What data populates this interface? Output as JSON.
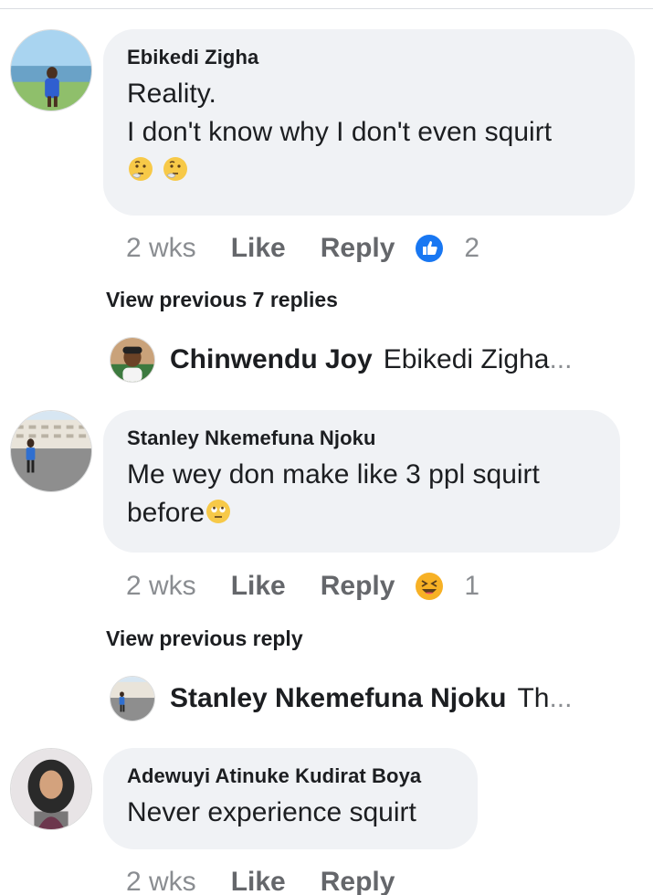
{
  "comments": [
    {
      "author": "Ebikedi Zigha",
      "lines": [
        "Reality.",
        "I don't know why I don't even squirt"
      ],
      "emojis": [
        "thinking-face",
        "thinking-face"
      ],
      "time": "2 wks",
      "like_label": "Like",
      "reply_label": "Reply",
      "reaction": {
        "icon": "like-reaction-icon",
        "count": "2",
        "color": "#1877f2"
      },
      "view_previous": "View previous 7 replies",
      "latest_reply": {
        "name": "Chinwendu Joy",
        "snippet": "Ebikedi Zigha",
        "ellipsis": "..."
      }
    },
    {
      "author": "Stanley Nkemefuna Njoku",
      "lines": [
        "Me wey don make like 3 ppl squirt",
        "before"
      ],
      "emojis": [
        "face-with-rolling-eyes"
      ],
      "time": "2 wks",
      "like_label": "Like",
      "reply_label": "Reply",
      "reaction": {
        "icon": "haha-reaction-icon",
        "count": "1",
        "color": "#f7b125"
      },
      "view_previous": "View previous reply",
      "latest_reply": {
        "name": "Stanley Nkemefuna Njoku",
        "snippet": "Th",
        "ellipsis": "..."
      }
    },
    {
      "author": "Adewuyi Atinuke Kudirat Boya",
      "lines": [
        "Never experience squirt"
      ],
      "time": "2 wks",
      "like_label": "Like",
      "reply_label": "Reply"
    }
  ],
  "colors": {
    "bubble": "#f0f2f5",
    "muted": "#65676b",
    "like_blue": "#1877f2"
  }
}
